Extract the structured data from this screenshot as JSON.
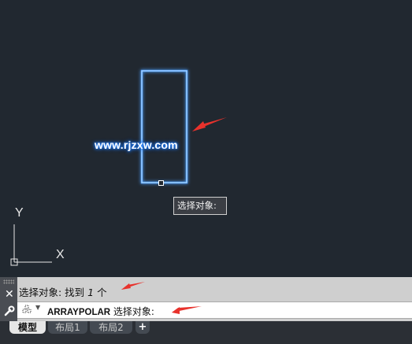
{
  "canvas": {
    "watermark": "www.rjzxw.com",
    "tooltip": "选择对象:",
    "ucs": {
      "y_label": "Y",
      "x_label": "X"
    }
  },
  "command_line": {
    "history": {
      "prefix": "选择对象: 找到",
      "count": "1",
      "suffix": "个"
    },
    "input": {
      "command": "ARRAYPOLAR",
      "prompt": "选择对象:"
    }
  },
  "tabs": [
    {
      "label": "模型",
      "active": true
    },
    {
      "label": "布局1",
      "active": false
    },
    {
      "label": "布局2",
      "active": false
    }
  ],
  "add_tab_label": "+",
  "colors": {
    "background": "#212830",
    "selection_glow": "#4ea0ff",
    "arrow": "#e8322c"
  },
  "icons": {
    "close": "close-icon",
    "customize": "wrench-icon",
    "command": "command-icon",
    "add_layout": "plus-icon"
  }
}
